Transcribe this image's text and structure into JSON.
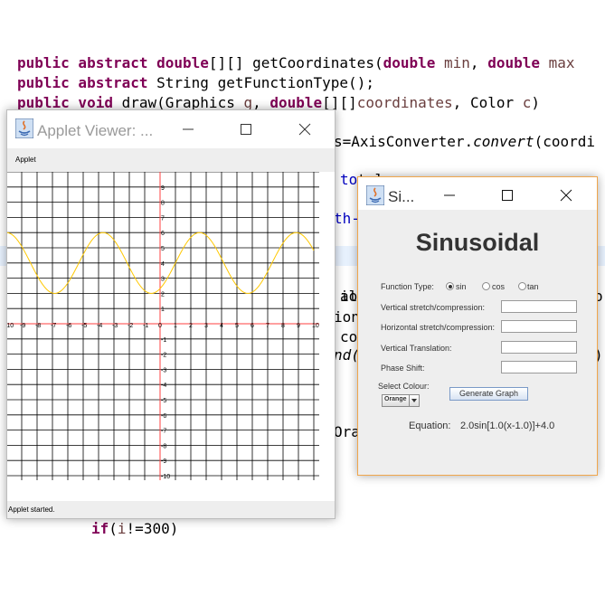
{
  "code": {
    "lines": [
      {
        "parts": [
          {
            "t": "public abstract double",
            "c": "kw"
          },
          {
            "t": "[][] getCoordinates(",
            "c": ""
          },
          {
            "t": "double",
            "c": "kw"
          },
          {
            "t": " ",
            "c": ""
          },
          {
            "t": "min",
            "c": "var"
          },
          {
            "t": ", ",
            "c": ""
          },
          {
            "t": "double",
            "c": "kw"
          },
          {
            "t": " ",
            "c": ""
          },
          {
            "t": "max",
            "c": "var"
          }
        ]
      },
      {
        "parts": [
          {
            "t": "public abstract",
            "c": "kw"
          },
          {
            "t": " String getFunctionType();",
            "c": ""
          }
        ]
      },
      {
        "parts": [
          {
            "t": "public void",
            "c": "kw"
          },
          {
            "t": " draw(Graphics ",
            "c": ""
          },
          {
            "t": "g",
            "c": "var"
          },
          {
            "t": ", ",
            "c": ""
          },
          {
            "t": "double",
            "c": "kw"
          },
          {
            "t": "[][]",
            "c": ""
          },
          {
            "t": "coordinates",
            "c": "var"
          },
          {
            "t": ", Color ",
            "c": ""
          },
          {
            "t": "c",
            "c": "var"
          },
          {
            "t": ")",
            "c": ""
          }
        ]
      },
      {
        "parts": [
          {
            "t": "s=AxisConverter.",
            "c": ""
          },
          {
            "t": "convert",
            "c": "it"
          },
          {
            "t": "(coordi",
            "c": ""
          }
        ]
      },
      {
        "parts": [
          {
            "t": "to",
            "c": "fld"
          },
          {
            "t": "tal",
            "c": ""
          }
        ]
      },
      {
        "parts": [
          {
            "t": "th-",
            "c": "fld"
          }
        ]
      },
      {
        "parts": [
          {
            "t": "al",
            "c": ""
          }
        ]
      },
      {
        "parts": [
          {
            "t": "io",
            "c": ""
          }
        ]
      },
      {
        "parts": [
          {
            "t": "ion",
            "c": ""
          }
        ]
      },
      {
        "parts": [
          {
            "t": "con",
            "c": ""
          }
        ]
      },
      {
        "parts": [
          {
            "t": "nd(",
            "c": "it"
          }
        ]
      },
      {
        "parts": [
          {
            "t": "Ora",
            "c": ""
          }
        ]
      },
      {
        "parts": [
          {
            "t": "if",
            "c": "kw"
          },
          {
            "t": "(",
            "c": ""
          },
          {
            "t": "i",
            "c": "var"
          },
          {
            "t": "!=300)",
            "c": ""
          }
        ]
      },
      {
        "parts": [
          {
            "t": "{",
            "c": ""
          }
        ]
      }
    ],
    "right_fragments": [
      {
        "t": "o"
      },
      {
        "t": ")"
      }
    ]
  },
  "applet_window": {
    "title": "Applet Viewer: ...",
    "menu_label": "Applet",
    "status_text": "Applet started.",
    "minimize_icon": "minimize-icon",
    "maximize_icon": "maximize-icon",
    "close_icon": "close-icon"
  },
  "graph": {
    "xmin": -10,
    "xmax": 10,
    "ymin": -10,
    "ymax": 10,
    "x_ticks": [
      -10,
      -9,
      -8,
      -7,
      -6,
      -5,
      -4,
      -3,
      -2,
      -1,
      0,
      1,
      2,
      3,
      4,
      5,
      6,
      7,
      8,
      9,
      10
    ],
    "y_ticks": [
      9,
      8,
      7,
      6,
      5,
      4,
      3,
      2,
      1,
      -1,
      -2,
      -3,
      -4,
      -5,
      -6,
      -7,
      -8,
      -9,
      -10
    ],
    "grid": true,
    "axis_color": "#ff4040",
    "curve_color": "#ffc800",
    "function": {
      "type": "sin",
      "a": 2.0,
      "b": 1.0,
      "h": 1.0,
      "k": 4.0
    }
  },
  "sin_window": {
    "title": "Si...",
    "heading": "Sinusoidal",
    "function_type_label": "Function Type:",
    "options": [
      {
        "label": "sin",
        "selected": true
      },
      {
        "label": "cos",
        "selected": false
      },
      {
        "label": "tan",
        "selected": false
      }
    ],
    "fields": [
      {
        "label": "Vertical stretch/compression:",
        "value": ""
      },
      {
        "label": "Horizontal stretch/compression:",
        "value": ""
      },
      {
        "label": "Vertical Translation:",
        "value": ""
      },
      {
        "label": "Phase Shift:",
        "value": ""
      }
    ],
    "select_colour_label": "Select Colour:",
    "colour_value": "Orange",
    "generate_button": "Generate Graph",
    "equation_label": "Equation:",
    "equation_value": "2.0sin[1.0(x-1.0)]+4.0",
    "accent": "#f0a64c"
  }
}
